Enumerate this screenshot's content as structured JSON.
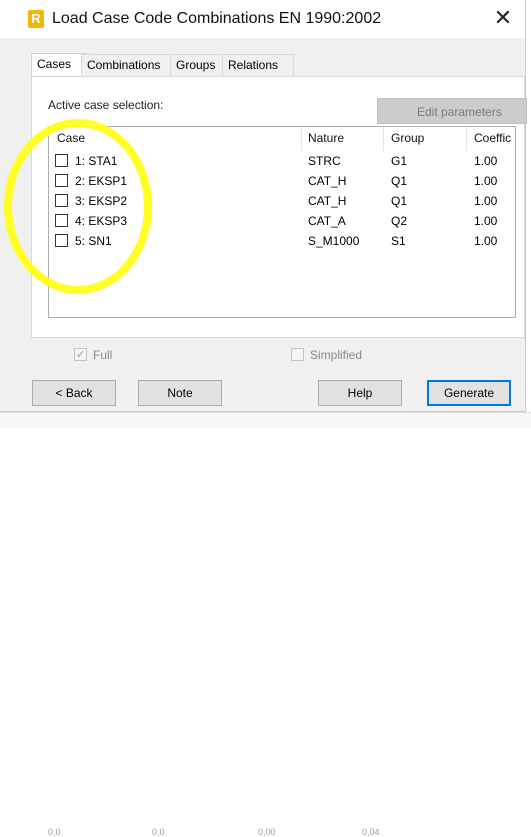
{
  "window": {
    "title": "Load Case Code Combinations EN 1990:2002",
    "app_icon_letter": "R",
    "close_symbol": "✕"
  },
  "tabs": [
    {
      "label": "Cases",
      "active": true
    },
    {
      "label": "Combinations",
      "active": false
    },
    {
      "label": "Groups",
      "active": false
    },
    {
      "label": "Relations",
      "active": false
    }
  ],
  "cases_panel": {
    "section_label": "Active case selection:",
    "edit_parameters_label": "Edit parameters",
    "columns": [
      "Case",
      "Nature",
      "Group",
      "Coeffic"
    ],
    "rows": [
      {
        "case": "1: STA1",
        "nature": "STRC",
        "group": "G1",
        "coeff": "1.00",
        "checked": false
      },
      {
        "case": "2: EKSP1",
        "nature": "CAT_H",
        "group": "Q1",
        "coeff": "1.00",
        "checked": false
      },
      {
        "case": "3: EKSP2",
        "nature": "CAT_H",
        "group": "Q1",
        "coeff": "1.00",
        "checked": false
      },
      {
        "case": "4: EKSP3",
        "nature": "CAT_A",
        "group": "Q2",
        "coeff": "1.00",
        "checked": false
      },
      {
        "case": "5: SN1",
        "nature": "S_M1000",
        "group": "S1",
        "coeff": "1.00",
        "checked": false
      }
    ]
  },
  "options": {
    "full_label": "Full",
    "full_checked": true,
    "simplified_label": "Simplified",
    "simplified_checked": false
  },
  "buttons": {
    "back": "< Back",
    "note": "Note",
    "help": "Help",
    "generate": "Generate"
  },
  "background_cells": [
    "0,0",
    "0,0",
    "0,00",
    "0,04"
  ],
  "colors": {
    "highlight": "#ffff1a",
    "accent": "#0078d7",
    "app_icon": "#f2b705"
  }
}
